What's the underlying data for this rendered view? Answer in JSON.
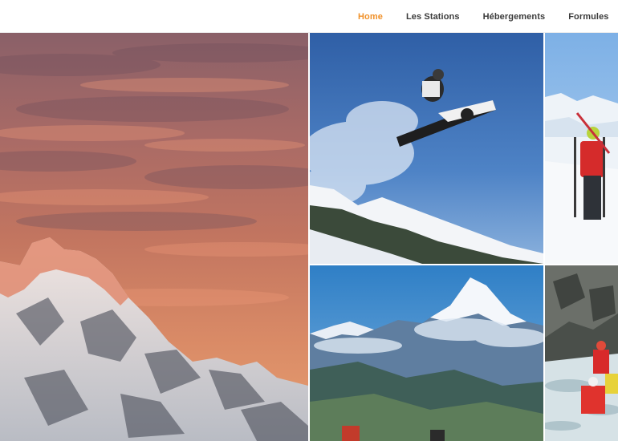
{
  "nav": {
    "items": [
      {
        "label": "Home",
        "active": true
      },
      {
        "label": "Les Stations",
        "active": false
      },
      {
        "label": "Hébergements",
        "active": false
      },
      {
        "label": "Formules",
        "active": false
      }
    ]
  },
  "gallery": {
    "tiles": [
      {
        "subject": "sunset-mountain-photo"
      },
      {
        "subject": "snowboarder-jump-photo"
      },
      {
        "subject": "ski-mountaineer-photo"
      },
      {
        "subject": "alpine-peak-photo"
      },
      {
        "subject": "rafting-photo"
      }
    ]
  },
  "colors": {
    "accent": "#f0912a",
    "nav_text": "#3b3b3b",
    "background": "#ffffff"
  }
}
